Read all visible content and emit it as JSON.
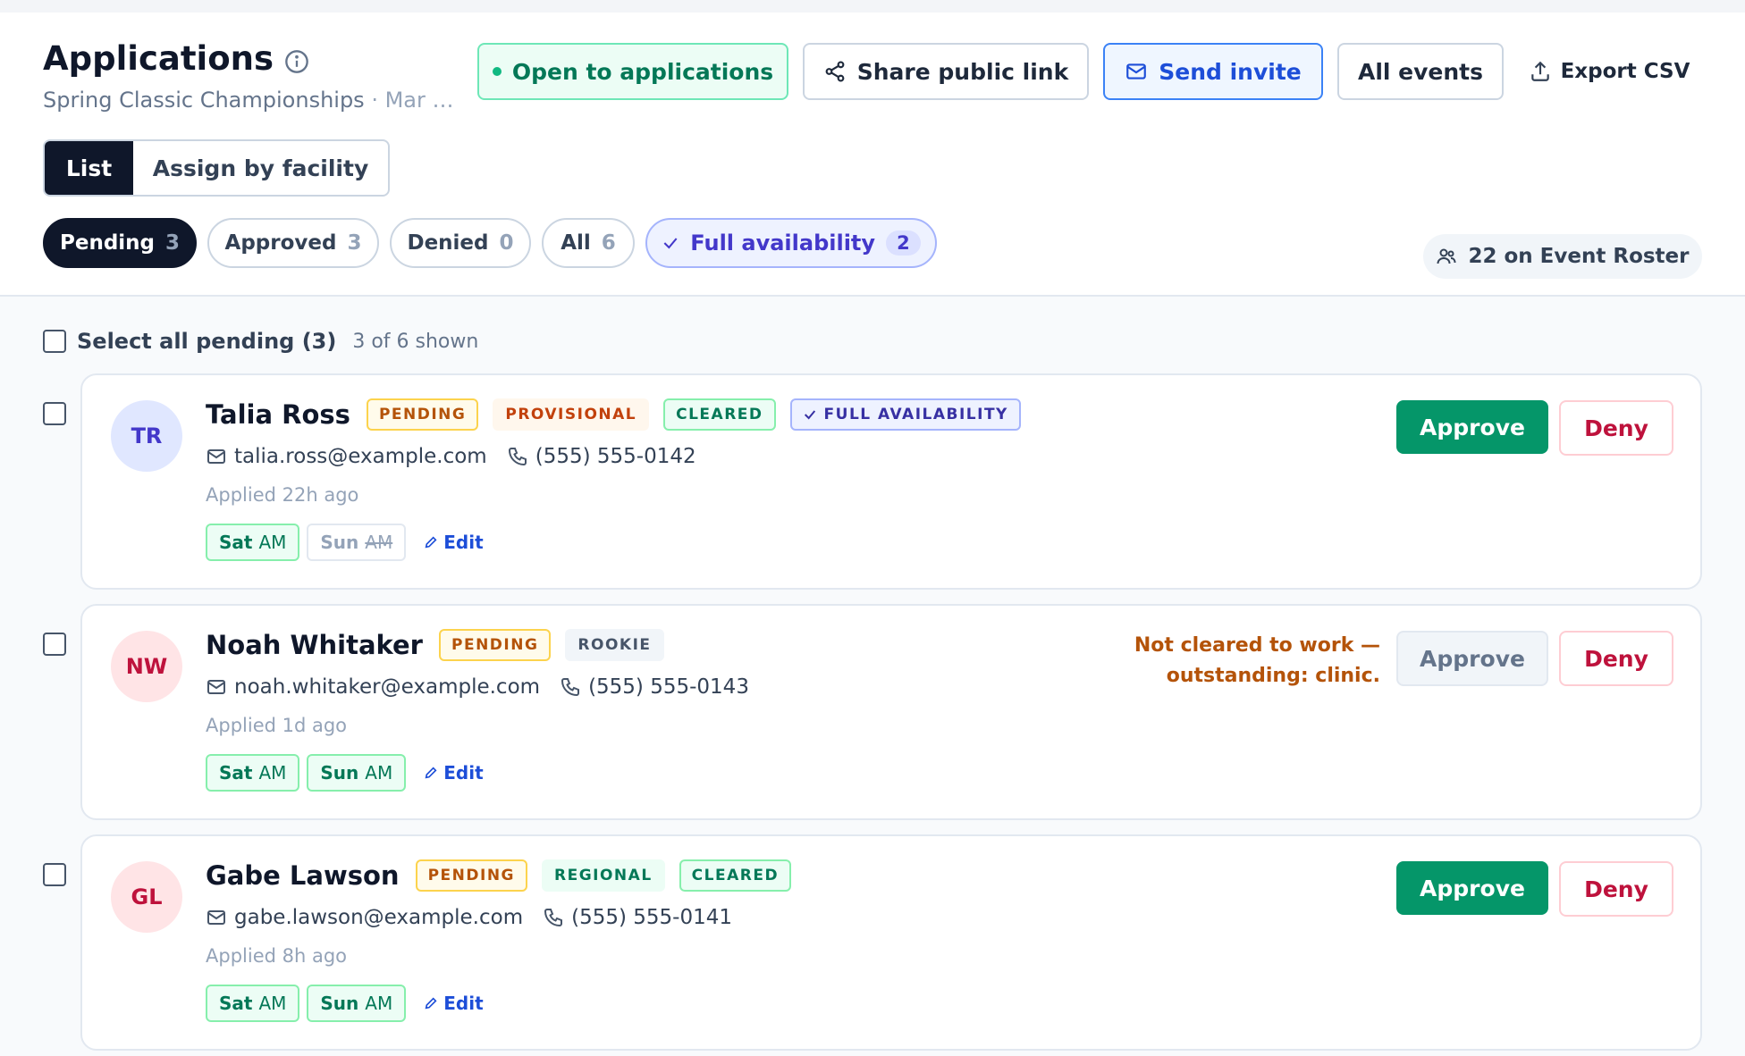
{
  "header": {
    "title": "Applications",
    "subtitle": "Spring Classic Championships",
    "subtitle_extra": " · Mar …",
    "buttons": {
      "open": "Open to applications",
      "share": "Share public link",
      "invite": "Send invite",
      "all_events": "All events",
      "export": "Export CSV"
    }
  },
  "view_toggle": {
    "list": "List",
    "assign": "Assign by facility"
  },
  "filters": [
    {
      "label": "Pending",
      "count": "3"
    },
    {
      "label": "Approved",
      "count": "3"
    },
    {
      "label": "Denied",
      "count": "0"
    },
    {
      "label": "All",
      "count": "6"
    },
    {
      "label": "Full availability",
      "count": "2"
    }
  ],
  "roster": "22 on Event Roster",
  "select_all": {
    "label": "Select all pending (3)",
    "shown": "3 of 6 shown"
  },
  "applicants": [
    {
      "initials": "TR",
      "name": "Talia Ross",
      "badges": [
        "PENDING",
        "PROVISIONAL",
        "CLEARED",
        "FULL AVAILABILITY"
      ],
      "email": "talia.ross@example.com",
      "phone": "(555) 555-0142",
      "applied": "Applied 22h ago",
      "slots": [
        {
          "day": "Sat",
          "period": "AM",
          "available": true
        },
        {
          "day": "Sun",
          "period": "AM",
          "available": false
        }
      ],
      "edit": "Edit",
      "approve": "Approve",
      "deny": "Deny",
      "warning": ""
    },
    {
      "initials": "NW",
      "name": "Noah Whitaker",
      "badges": [
        "PENDING",
        "ROOKIE"
      ],
      "email": "noah.whitaker@example.com",
      "phone": "(555) 555-0143",
      "applied": "Applied 1d ago",
      "slots": [
        {
          "day": "Sat",
          "period": "AM",
          "available": true
        },
        {
          "day": "Sun",
          "period": "AM",
          "available": true
        }
      ],
      "edit": "Edit",
      "approve": "Approve",
      "deny": "Deny",
      "warning_line1": "Not cleared to work —",
      "warning_line2": "outstanding: clinic."
    },
    {
      "initials": "GL",
      "name": "Gabe Lawson",
      "badges": [
        "PENDING",
        "REGIONAL",
        "CLEARED"
      ],
      "email": "gabe.lawson@example.com",
      "phone": "(555) 555-0141",
      "applied": "Applied 8h ago",
      "slots": [
        {
          "day": "Sat",
          "period": "AM",
          "available": true
        },
        {
          "day": "Sun",
          "period": "AM",
          "available": true
        }
      ],
      "edit": "Edit",
      "approve": "Approve",
      "deny": "Deny",
      "warning": ""
    }
  ],
  "colors": {
    "primary_dark": "#0f172a",
    "approve_green": "#059669",
    "deny_red": "#be123c",
    "accent_blue": "#1d4ed8",
    "accent_indigo": "#4338ca"
  }
}
